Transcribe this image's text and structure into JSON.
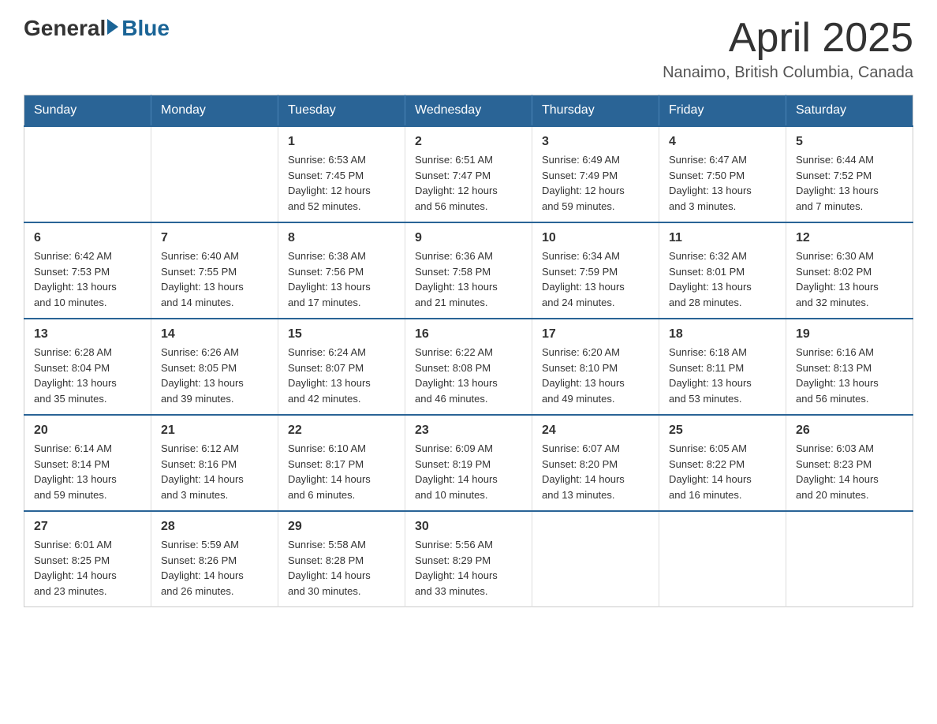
{
  "logo": {
    "general": "General",
    "blue": "Blue"
  },
  "header": {
    "month": "April 2025",
    "location": "Nanaimo, British Columbia, Canada"
  },
  "weekdays": [
    "Sunday",
    "Monday",
    "Tuesday",
    "Wednesday",
    "Thursday",
    "Friday",
    "Saturday"
  ],
  "weeks": [
    [
      {
        "day": "",
        "info": ""
      },
      {
        "day": "",
        "info": ""
      },
      {
        "day": "1",
        "info": "Sunrise: 6:53 AM\nSunset: 7:45 PM\nDaylight: 12 hours\nand 52 minutes."
      },
      {
        "day": "2",
        "info": "Sunrise: 6:51 AM\nSunset: 7:47 PM\nDaylight: 12 hours\nand 56 minutes."
      },
      {
        "day": "3",
        "info": "Sunrise: 6:49 AM\nSunset: 7:49 PM\nDaylight: 12 hours\nand 59 minutes."
      },
      {
        "day": "4",
        "info": "Sunrise: 6:47 AM\nSunset: 7:50 PM\nDaylight: 13 hours\nand 3 minutes."
      },
      {
        "day": "5",
        "info": "Sunrise: 6:44 AM\nSunset: 7:52 PM\nDaylight: 13 hours\nand 7 minutes."
      }
    ],
    [
      {
        "day": "6",
        "info": "Sunrise: 6:42 AM\nSunset: 7:53 PM\nDaylight: 13 hours\nand 10 minutes."
      },
      {
        "day": "7",
        "info": "Sunrise: 6:40 AM\nSunset: 7:55 PM\nDaylight: 13 hours\nand 14 minutes."
      },
      {
        "day": "8",
        "info": "Sunrise: 6:38 AM\nSunset: 7:56 PM\nDaylight: 13 hours\nand 17 minutes."
      },
      {
        "day": "9",
        "info": "Sunrise: 6:36 AM\nSunset: 7:58 PM\nDaylight: 13 hours\nand 21 minutes."
      },
      {
        "day": "10",
        "info": "Sunrise: 6:34 AM\nSunset: 7:59 PM\nDaylight: 13 hours\nand 24 minutes."
      },
      {
        "day": "11",
        "info": "Sunrise: 6:32 AM\nSunset: 8:01 PM\nDaylight: 13 hours\nand 28 minutes."
      },
      {
        "day": "12",
        "info": "Sunrise: 6:30 AM\nSunset: 8:02 PM\nDaylight: 13 hours\nand 32 minutes."
      }
    ],
    [
      {
        "day": "13",
        "info": "Sunrise: 6:28 AM\nSunset: 8:04 PM\nDaylight: 13 hours\nand 35 minutes."
      },
      {
        "day": "14",
        "info": "Sunrise: 6:26 AM\nSunset: 8:05 PM\nDaylight: 13 hours\nand 39 minutes."
      },
      {
        "day": "15",
        "info": "Sunrise: 6:24 AM\nSunset: 8:07 PM\nDaylight: 13 hours\nand 42 minutes."
      },
      {
        "day": "16",
        "info": "Sunrise: 6:22 AM\nSunset: 8:08 PM\nDaylight: 13 hours\nand 46 minutes."
      },
      {
        "day": "17",
        "info": "Sunrise: 6:20 AM\nSunset: 8:10 PM\nDaylight: 13 hours\nand 49 minutes."
      },
      {
        "day": "18",
        "info": "Sunrise: 6:18 AM\nSunset: 8:11 PM\nDaylight: 13 hours\nand 53 minutes."
      },
      {
        "day": "19",
        "info": "Sunrise: 6:16 AM\nSunset: 8:13 PM\nDaylight: 13 hours\nand 56 minutes."
      }
    ],
    [
      {
        "day": "20",
        "info": "Sunrise: 6:14 AM\nSunset: 8:14 PM\nDaylight: 13 hours\nand 59 minutes."
      },
      {
        "day": "21",
        "info": "Sunrise: 6:12 AM\nSunset: 8:16 PM\nDaylight: 14 hours\nand 3 minutes."
      },
      {
        "day": "22",
        "info": "Sunrise: 6:10 AM\nSunset: 8:17 PM\nDaylight: 14 hours\nand 6 minutes."
      },
      {
        "day": "23",
        "info": "Sunrise: 6:09 AM\nSunset: 8:19 PM\nDaylight: 14 hours\nand 10 minutes."
      },
      {
        "day": "24",
        "info": "Sunrise: 6:07 AM\nSunset: 8:20 PM\nDaylight: 14 hours\nand 13 minutes."
      },
      {
        "day": "25",
        "info": "Sunrise: 6:05 AM\nSunset: 8:22 PM\nDaylight: 14 hours\nand 16 minutes."
      },
      {
        "day": "26",
        "info": "Sunrise: 6:03 AM\nSunset: 8:23 PM\nDaylight: 14 hours\nand 20 minutes."
      }
    ],
    [
      {
        "day": "27",
        "info": "Sunrise: 6:01 AM\nSunset: 8:25 PM\nDaylight: 14 hours\nand 23 minutes."
      },
      {
        "day": "28",
        "info": "Sunrise: 5:59 AM\nSunset: 8:26 PM\nDaylight: 14 hours\nand 26 minutes."
      },
      {
        "day": "29",
        "info": "Sunrise: 5:58 AM\nSunset: 8:28 PM\nDaylight: 14 hours\nand 30 minutes."
      },
      {
        "day": "30",
        "info": "Sunrise: 5:56 AM\nSunset: 8:29 PM\nDaylight: 14 hours\nand 33 minutes."
      },
      {
        "day": "",
        "info": ""
      },
      {
        "day": "",
        "info": ""
      },
      {
        "day": "",
        "info": ""
      }
    ]
  ]
}
